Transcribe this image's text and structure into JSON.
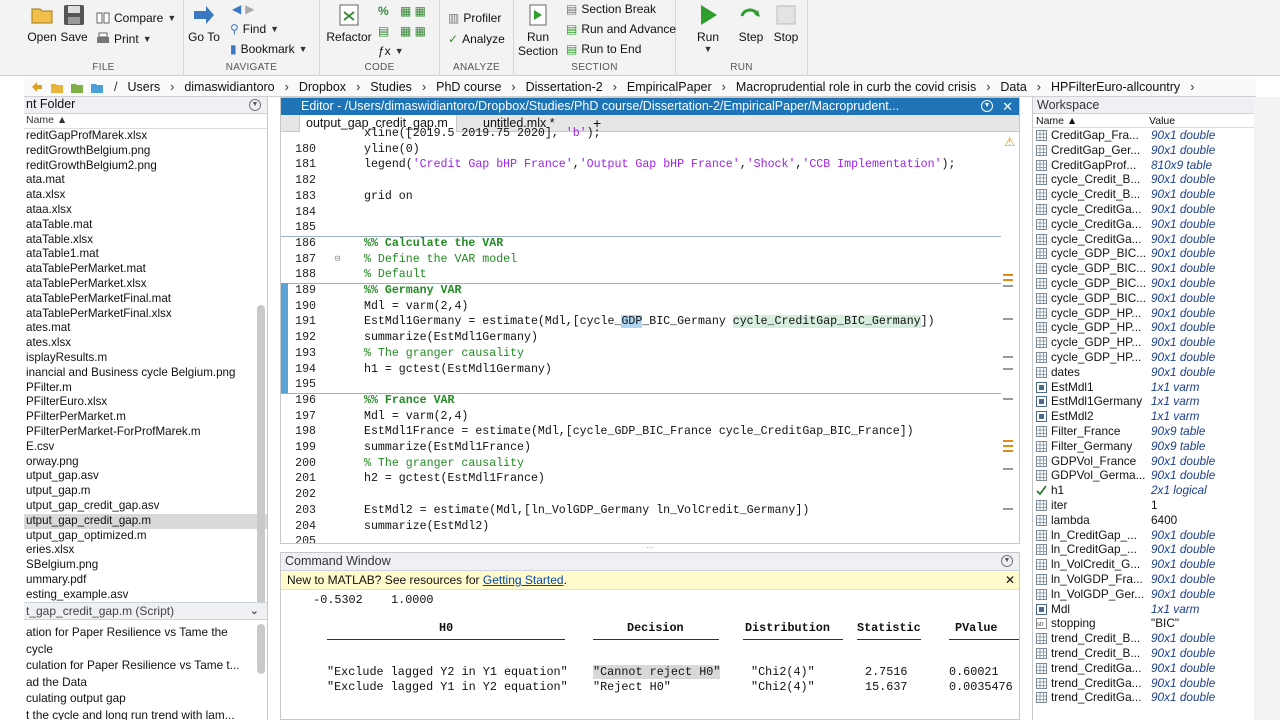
{
  "toolstrip": {
    "file": {
      "group": "FILE",
      "open": "Open",
      "save": "Save",
      "compare": "Compare",
      "print": "Print"
    },
    "navigate": {
      "group": "NAVIGATE",
      "goto": "Go To",
      "find": "Find",
      "bookmark": "Bookmark"
    },
    "code": {
      "group": "CODE",
      "refactor": "Refactor"
    },
    "analyze": {
      "group": "ANALYZE",
      "profiler": "Profiler",
      "analyze": "Analyze"
    },
    "section": {
      "group": "SECTION",
      "run_section": "Run Section",
      "section_break": "Section Break",
      "run_and_advance": "Run and Advance",
      "run_to_end": "Run to End"
    },
    "run": {
      "group": "RUN",
      "run": "Run",
      "step": "Step",
      "stop": "Stop"
    }
  },
  "address": {
    "crumbs": [
      "Users",
      "dimaswidiantoro",
      "Dropbox",
      "Studies",
      "PhD course",
      "Dissertation-2",
      "EmpiricalPaper",
      "Macroprudential role in curb the covid crisis",
      "Data",
      "HPFilterEuro-allcountry"
    ]
  },
  "folder": {
    "title": "nt Folder",
    "col_name": "Name ▲",
    "files": [
      "reditGapProfMarek.xlsx",
      "reditGrowthBelgium.png",
      "reditGrowthBelgium2.png",
      "ata.mat",
      "ata.xlsx",
      "ataa.xlsx",
      "ataTable.mat",
      "ataTable.xlsx",
      "ataTable1.mat",
      "ataTablePerMarket.mat",
      "ataTablePerMarket.xlsx",
      "ataTablePerMarketFinal.mat",
      "ataTablePerMarketFinal.xlsx",
      "ates.mat",
      "ates.xlsx",
      "isplayResults.m",
      "inancial and Business cycle Belgium.png",
      "PFilter.m",
      "PFilterEuro.xlsx",
      "PFilterPerMarket.m",
      "PFilterPerMarket-ForProfMarek.m",
      "E.csv",
      "orway.png",
      "utput_gap.asv",
      "utput_gap.m",
      "utput_gap_credit_gap.asv",
      "utput_gap_credit_gap.m",
      "utput_gap_optimized.m",
      "eries.xlsx",
      "SBelgium.png",
      "ummary.pdf",
      "esting_example.asv"
    ],
    "selected_index": 26,
    "detail_title": "t_gap_credit_gap.m  (Script)",
    "detail_lines": [
      "ation for Paper Resilience vs Tame the",
      " cycle",
      "culation for Paper Resilience vs Tame t...",
      "ad the Data",
      "culating output gap",
      "t the cycle and long run trend with lam..."
    ]
  },
  "editor": {
    "title": "Editor - /Users/dimaswidiantoro/Dropbox/Studies/PhD course/Dissertation-2/EmpiricalPaper/Macroprudent...",
    "tabs": [
      "output_gap_credit_gap.m",
      "untitled.mlx *",
      "+"
    ],
    "lines": [
      {
        "n": "",
        "t": "xline([2019.5 2019.75 2020], 'b');"
      },
      {
        "n": "180",
        "t": "yline(0)"
      },
      {
        "n": "181",
        "t": "legend('Credit Gap bHP France','Output Gap bHP France','Shock','CCB Implementation');"
      },
      {
        "n": "182",
        "t": ""
      },
      {
        "n": "183",
        "t": "grid on"
      },
      {
        "n": "184",
        "t": ""
      },
      {
        "n": "185",
        "t": ""
      },
      {
        "n": "186",
        "t": "%% Calculate the VAR"
      },
      {
        "n": "187",
        "t": "% Define the VAR model"
      },
      {
        "n": "188",
        "t": "% Default"
      },
      {
        "n": "189",
        "t": "%% Germany VAR"
      },
      {
        "n": "190",
        "t": "Mdl = varm(2,4)"
      },
      {
        "n": "191",
        "t": "EstMdl1Germany = estimate(Mdl,[cycle_GDP_BIC_Germany cycle_CreditGap_BIC_Germany])"
      },
      {
        "n": "192",
        "t": "summarize(EstMdl1Germany)"
      },
      {
        "n": "193",
        "t": "% The granger causality"
      },
      {
        "n": "194",
        "t": "h1 = gctest(EstMdl1Germany)"
      },
      {
        "n": "195",
        "t": ""
      },
      {
        "n": "196",
        "t": "%% France VAR"
      },
      {
        "n": "197",
        "t": "Mdl = varm(2,4)"
      },
      {
        "n": "198",
        "t": "EstMdl1France = estimate(Mdl,[cycle_GDP_BIC_France cycle_CreditGap_BIC_France])"
      },
      {
        "n": "199",
        "t": "summarize(EstMdl1France)"
      },
      {
        "n": "200",
        "t": "% The granger causality"
      },
      {
        "n": "201",
        "t": "h2 = gctest(EstMdl1France)"
      },
      {
        "n": "202",
        "t": ""
      },
      {
        "n": "203",
        "t": "EstMdl2 = estimate(Mdl,[ln_VolGDP_Germany ln_VolCredit_Germany])"
      },
      {
        "n": "204",
        "t": "summarize(EstMdl2)"
      },
      {
        "n": "205",
        "t": ""
      }
    ]
  },
  "command": {
    "title": "Command Window",
    "new_text": "New to MATLAB? See resources for ",
    "new_link": "Getting Started",
    "new_end": ".",
    "prev_line": "  -0.5302    1.0000",
    "headers": [
      "H0",
      "Decision",
      "Distribution",
      "Statistic",
      "PValue"
    ],
    "rows": [
      [
        "\"Exclude lagged Y2 in Y1 equation\"",
        "\"Cannot reject H0\"",
        "\"Chi2(4)\"",
        "2.7516",
        "0.60021"
      ],
      [
        "\"Exclude lagged Y1 in Y2 equation\"",
        "\"Reject H0\"",
        "\"Chi2(4)\"",
        "15.637",
        "0.0035476"
      ]
    ]
  },
  "workspace": {
    "title": "Workspace",
    "col_name": "Name ▲",
    "col_value": "Value",
    "vars": [
      {
        "name": "CreditGap_Fra...",
        "value": "90x1 double",
        "kind": "table"
      },
      {
        "name": "CreditGap_Ger...",
        "value": "90x1 double",
        "kind": "table"
      },
      {
        "name": "CreditGapProf...",
        "value": "810x9 table",
        "kind": "table"
      },
      {
        "name": "cycle_Credit_B...",
        "value": "90x1 double",
        "kind": "table"
      },
      {
        "name": "cycle_Credit_B...",
        "value": "90x1 double",
        "kind": "table"
      },
      {
        "name": "cycle_CreditGa...",
        "value": "90x1 double",
        "kind": "table"
      },
      {
        "name": "cycle_CreditGa...",
        "value": "90x1 double",
        "kind": "table"
      },
      {
        "name": "cycle_CreditGa...",
        "value": "90x1 double",
        "kind": "table"
      },
      {
        "name": "cycle_GDP_BIC...",
        "value": "90x1 double",
        "kind": "table"
      },
      {
        "name": "cycle_GDP_BIC...",
        "value": "90x1 double",
        "kind": "table"
      },
      {
        "name": "cycle_GDP_BIC...",
        "value": "90x1 double",
        "kind": "table"
      },
      {
        "name": "cycle_GDP_BIC...",
        "value": "90x1 double",
        "kind": "table"
      },
      {
        "name": "cycle_GDP_HP...",
        "value": "90x1 double",
        "kind": "table"
      },
      {
        "name": "cycle_GDP_HP...",
        "value": "90x1 double",
        "kind": "table"
      },
      {
        "name": "cycle_GDP_HP...",
        "value": "90x1 double",
        "kind": "table"
      },
      {
        "name": "cycle_GDP_HP...",
        "value": "90x1 double",
        "kind": "table"
      },
      {
        "name": "dates",
        "value": "90x1 double",
        "kind": "table"
      },
      {
        "name": "EstMdl1",
        "value": "1x1 varm",
        "kind": "obj"
      },
      {
        "name": "EstMdl1Germany",
        "value": "1x1 varm",
        "kind": "obj"
      },
      {
        "name": "EstMdl2",
        "value": "1x1 varm",
        "kind": "obj"
      },
      {
        "name": "Filter_France",
        "value": "90x9 table",
        "kind": "table"
      },
      {
        "name": "Filter_Germany",
        "value": "90x9 table",
        "kind": "table"
      },
      {
        "name": "GDPVol_France",
        "value": "90x1 double",
        "kind": "table"
      },
      {
        "name": "GDPVol_Germa...",
        "value": "90x1 double",
        "kind": "table"
      },
      {
        "name": "h1",
        "value": "2x1 logical",
        "kind": "check"
      },
      {
        "name": "iter",
        "value": "1",
        "kind": "table",
        "plain": true
      },
      {
        "name": "lambda",
        "value": "6400",
        "kind": "table",
        "plain": true
      },
      {
        "name": "ln_CreditGap_...",
        "value": "90x1 double",
        "kind": "table"
      },
      {
        "name": "ln_CreditGap_...",
        "value": "90x1 double",
        "kind": "table"
      },
      {
        "name": "ln_VolCredit_G...",
        "value": "90x1 double",
        "kind": "table"
      },
      {
        "name": "ln_VolGDP_Fra...",
        "value": "90x1 double",
        "kind": "table"
      },
      {
        "name": "ln_VolGDP_Ger...",
        "value": "90x1 double",
        "kind": "table"
      },
      {
        "name": "Mdl",
        "value": "1x1 varm",
        "kind": "obj"
      },
      {
        "name": "stopping",
        "value": "\"BIC\"",
        "kind": "str",
        "plain": true
      },
      {
        "name": "trend_Credit_B...",
        "value": "90x1 double",
        "kind": "table"
      },
      {
        "name": "trend_Credit_B...",
        "value": "90x1 double",
        "kind": "table"
      },
      {
        "name": "trend_CreditGa...",
        "value": "90x1 double",
        "kind": "table"
      },
      {
        "name": "trend_CreditGa...",
        "value": "90x1 double",
        "kind": "table"
      },
      {
        "name": "trend_CreditGa...",
        "value": "90x1 double",
        "kind": "table"
      }
    ]
  },
  "colors": {
    "accent": "#1f73b7",
    "cell_title": "#228b22",
    "string": "#a020f0",
    "ws_value": "#1c3f8f"
  }
}
